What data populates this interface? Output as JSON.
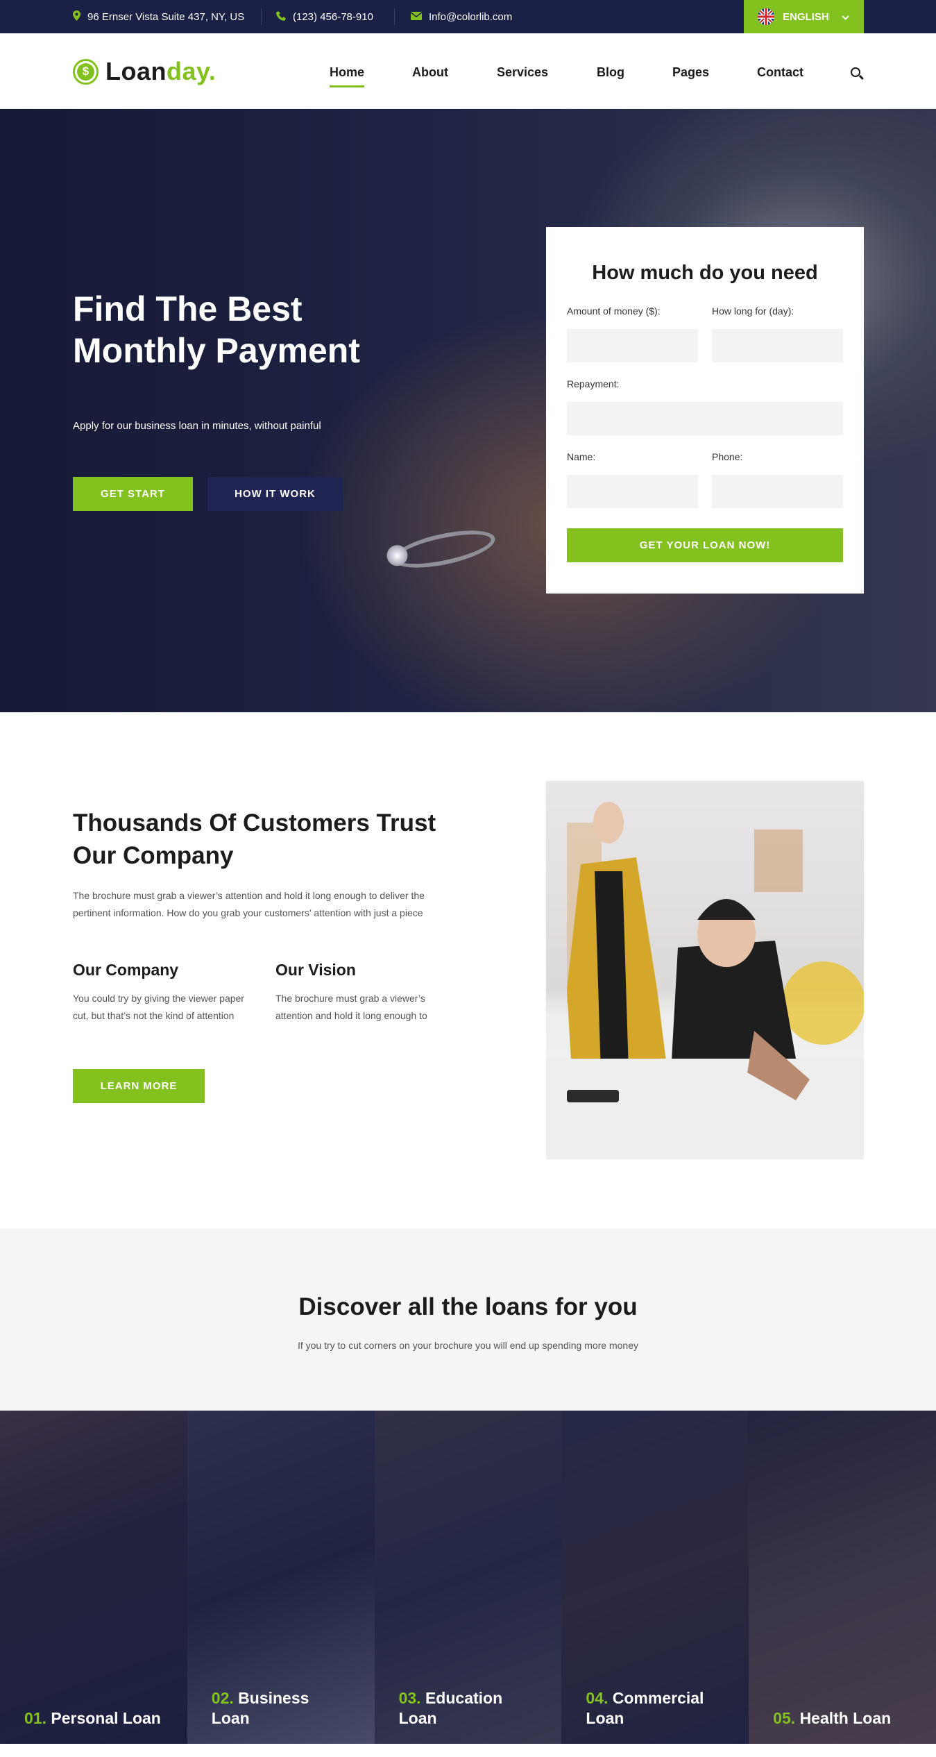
{
  "topbar": {
    "address": "96 Ernser Vista Suite 437, NY, US",
    "phone": "(123) 456-78-910",
    "email": "Info@colorlib.com",
    "language": "ENGLISH"
  },
  "header": {
    "logo_part1": "Loan",
    "logo_part2": "day.",
    "logo_symbol": "$",
    "nav": [
      "Home",
      "About",
      "Services",
      "Blog",
      "Pages",
      "Contact"
    ],
    "active_nav": "Home"
  },
  "hero": {
    "title": "Find The Best Monthly Payment",
    "subtitle": "Apply for our business loan in minutes, without painful",
    "primary_button": "GET START",
    "secondary_button": "HOW IT WORK"
  },
  "loan_form": {
    "title": "How much do you need",
    "amount_label": "Amount of money ($):",
    "duration_label": "How long for (day):",
    "repayment_label": "Repayment:",
    "name_label": "Name:",
    "phone_label": "Phone:",
    "submit": "GET YOUR LOAN NOW!"
  },
  "about": {
    "title": "Thousands Of Customers Trust Our Company",
    "lead": "The brochure must grab a viewer’s attention and hold it long enough to deliver the pertinent information. How do you grab your customers’ attention with just a piece",
    "company_title": "Our Company",
    "company_text": "You could try by giving the viewer paper cut, but that’s not the kind of attention",
    "vision_title": "Our Vision",
    "vision_text": "The brochure must grab a viewer’s attention and hold it long enough to",
    "button": "LEARN MORE"
  },
  "discover": {
    "title": "Discover all the loans for you",
    "subtitle": "If you try to cut corners on your brochure you will end up spending more money"
  },
  "loans": [
    {
      "number": "01.",
      "name": "Personal Loan"
    },
    {
      "number": "02.",
      "name": "Business Loan"
    },
    {
      "number": "03.",
      "name": "Education Loan"
    },
    {
      "number": "04.",
      "name": "Commercial Loan"
    },
    {
      "number": "05.",
      "name": "Health Loan"
    }
  ],
  "colors": {
    "accent": "#83c11f",
    "navy": "#1b2046"
  }
}
